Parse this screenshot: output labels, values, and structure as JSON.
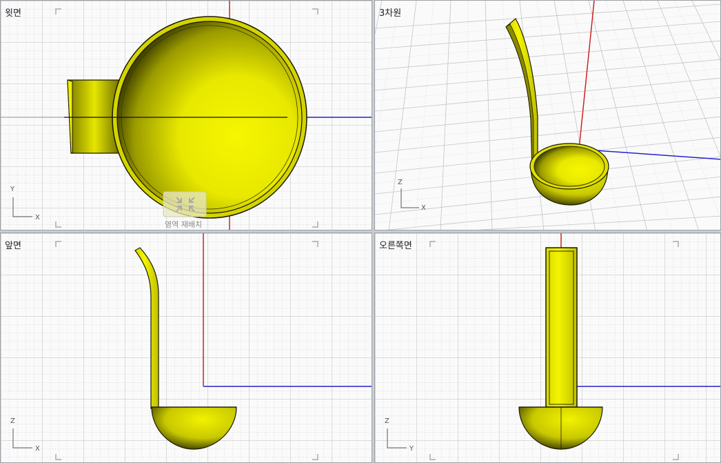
{
  "viewports": {
    "top": {
      "title": "윗면",
      "axis_x": "X",
      "axis_y": "Y",
      "widget_label": "영역 재배치"
    },
    "perspective": {
      "title": "3차원",
      "axis_x": "X",
      "axis_y": "Z"
    },
    "front": {
      "title": "앞면",
      "axis_x": "X",
      "axis_y": "Z"
    },
    "right": {
      "title": "오른쪽면",
      "axis_x": "Y",
      "axis_y": "Z"
    }
  },
  "colors": {
    "object": "#e6e600",
    "object_outline": "#1a1a00",
    "x_axis": "#2222cc",
    "y_axis": "#cc2222",
    "grid_minor": "#d8d8d8",
    "grid_major": "#bdbdbd",
    "viewport_bg": "#fafafa",
    "frame": "#c9cdd2"
  },
  "icons": {
    "rearrange": "area-rearrange-icon",
    "axis_indicator": "axis-triad-icon"
  }
}
